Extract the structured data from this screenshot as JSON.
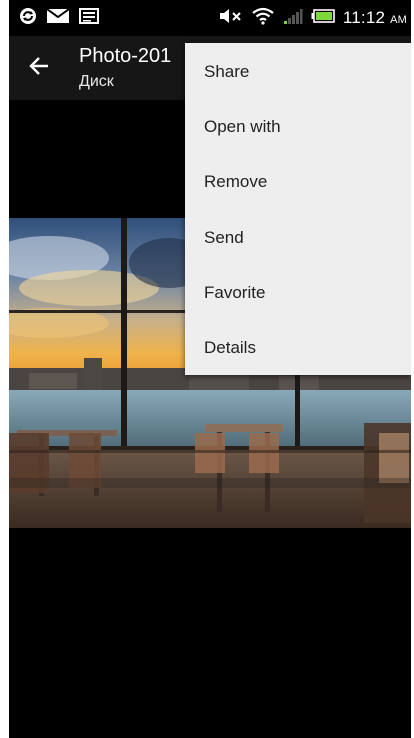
{
  "status_bar": {
    "time": "11:12",
    "ampm": "AM",
    "icons": [
      "sync-icon",
      "mail-icon",
      "image-icon",
      "mute-icon",
      "wifi-icon",
      "signal-icon",
      "battery-icon"
    ]
  },
  "action_bar": {
    "back_icon": "arrow-left-icon",
    "title": "Photo-201",
    "subtitle": "Диск"
  },
  "menu": {
    "items": [
      {
        "label": "Share"
      },
      {
        "label": "Open with"
      },
      {
        "label": "Remove"
      },
      {
        "label": "Send"
      },
      {
        "label": "Favorite"
      },
      {
        "label": "Details"
      }
    ]
  },
  "colors": {
    "status_bar_bg": "#000000",
    "action_bar_bg": "#161616",
    "menu_bg": "#eeeeee",
    "battery_green": "#7dd63a"
  }
}
